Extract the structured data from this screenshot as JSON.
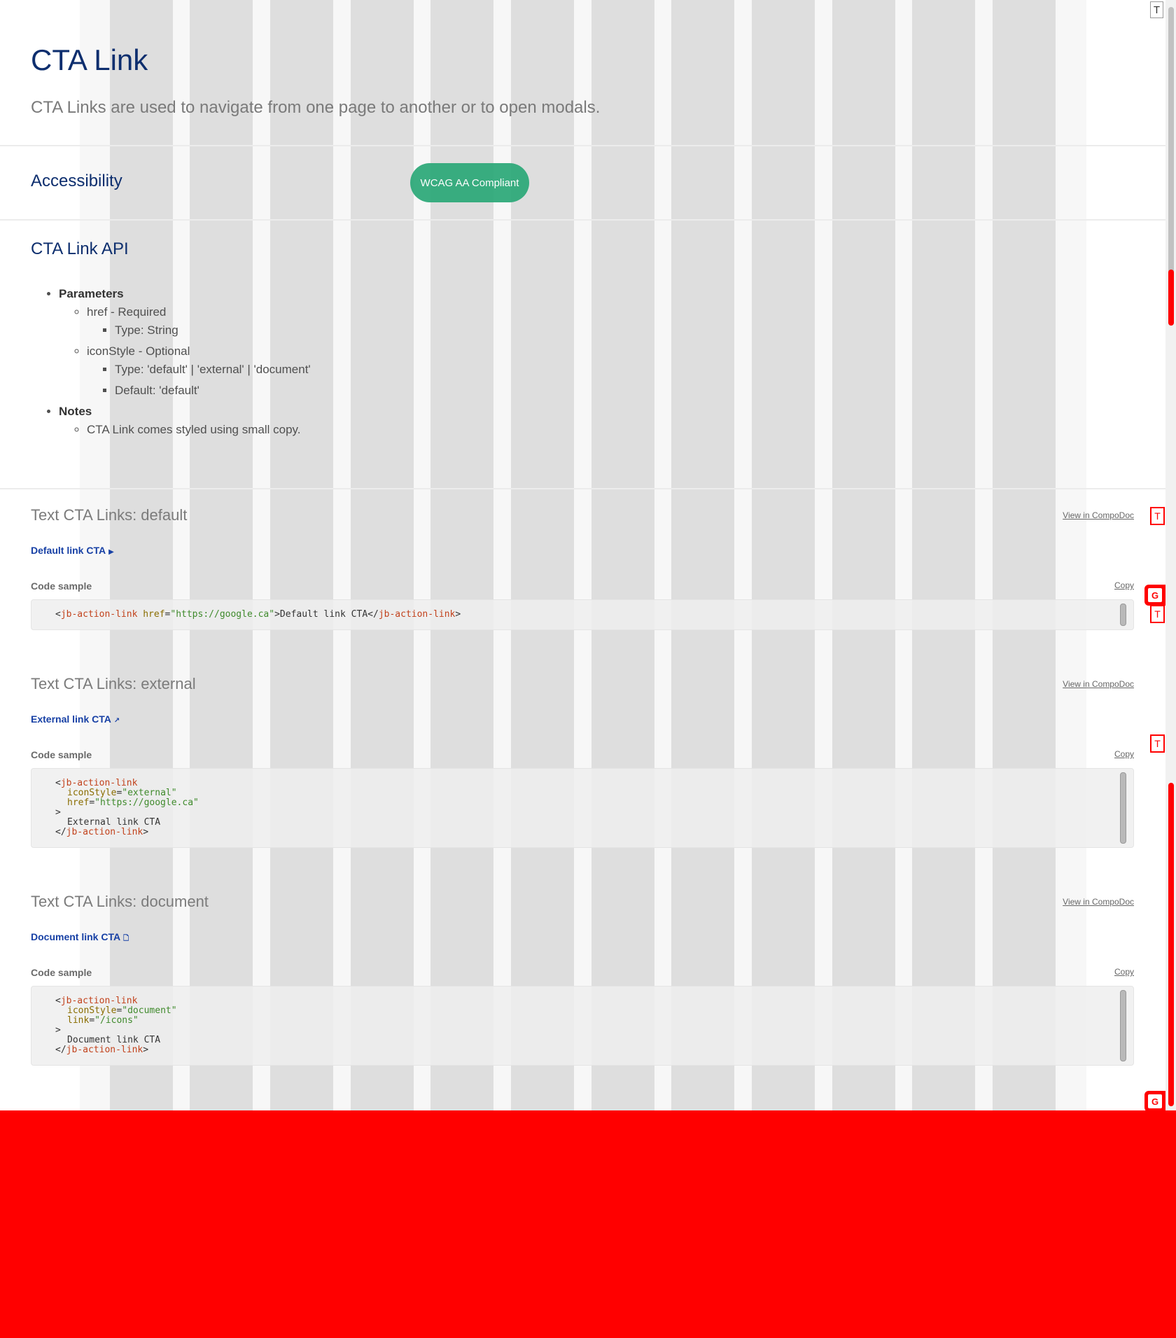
{
  "header": {
    "title": "CTA Link",
    "subtitle": "CTA Links are used to navigate from one page to another or to open modals."
  },
  "accessibility": {
    "heading": "Accessibility",
    "badge": "WCAG AA Compliant"
  },
  "api": {
    "heading": "CTA Link API",
    "parameters_label": "Parameters",
    "href_label": "href - Required",
    "href_type": "Type: String",
    "iconstyle_label": "iconStyle - Optional",
    "iconstyle_type": "Type: 'default' | 'external' | 'document'",
    "iconstyle_default": "Default: 'default'",
    "notes_label": "Notes",
    "notes_item": "CTA Link comes styled using small copy."
  },
  "sections": [
    {
      "title": "Text CTA Links: default",
      "compodoc": "View in CompoDoc",
      "link_label": "Default link CTA",
      "link_icon": "caret-right-icon",
      "code_label": "Code sample",
      "copy_label": "Copy"
    },
    {
      "title": "Text CTA Links: external",
      "compodoc": "View in CompoDoc",
      "link_label": "External link CTA",
      "link_icon": "external-arrow-icon",
      "code_label": "Code sample",
      "copy_label": "Copy"
    },
    {
      "title": "Text CTA Links: document",
      "compodoc": "View in CompoDoc",
      "link_label": "Document link CTA",
      "link_icon": "document-icon",
      "code_label": "Code sample",
      "copy_label": "Copy"
    }
  ],
  "code": {
    "default_line": {
      "open": "<",
      "tag": "jb-action-link",
      "attr": "href",
      "eq": "=",
      "value": "\"https://google.ca\"",
      "text": ">Default link CTA</",
      "close_tag": "jb-action-link",
      "end": ">"
    },
    "external": {
      "tag_open": "jb-action-link",
      "attr1": "iconStyle",
      "val1": "\"external\"",
      "attr2": "href",
      "val2": "\"https://google.ca\"",
      "body": "External link CTA",
      "tag_close": "jb-action-link"
    },
    "document": {
      "tag_open": "jb-action-link",
      "attr1": "iconStyle",
      "val1": "\"document\"",
      "attr2": "link",
      "val2": "\"/icons\"",
      "body": "Document link CTA",
      "tag_close": "jb-action-link"
    }
  },
  "tool_badges": {
    "t": "T",
    "g": "G"
  },
  "colors": {
    "title": "#0d2e6e",
    "link": "#1740a5",
    "badge": "#2aa878",
    "overlay_red": "#ff0000"
  }
}
